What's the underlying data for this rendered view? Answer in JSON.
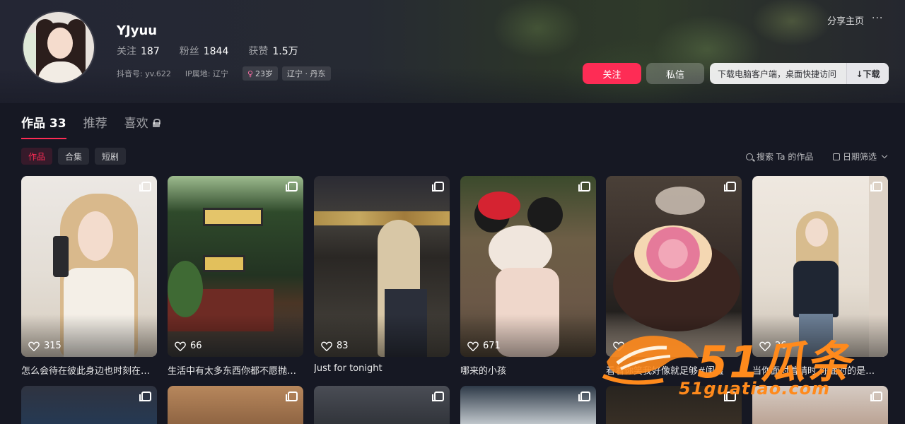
{
  "profile": {
    "username": "YJyuu",
    "stats": [
      {
        "label": "关注",
        "value": "187"
      },
      {
        "label": "粉丝",
        "value": "1844"
      },
      {
        "label": "获赞",
        "value": "1.5万"
      }
    ],
    "douyin_id": "抖音号: yv.622",
    "ip_location": "IP属地: 辽宁",
    "age_tag": "23岁",
    "region_tag": "辽宁 · 丹东"
  },
  "header_actions": {
    "share": "分享主页",
    "more": "···",
    "follow": "关注",
    "message": "私信",
    "download_text": "下载电脑客户端，桌面快捷访问",
    "download_button": "↓下载"
  },
  "tabs": [
    {
      "label": "作品 33",
      "active": true
    },
    {
      "label": "推荐",
      "active": false
    },
    {
      "label": "喜欢",
      "active": false,
      "locked": true
    }
  ],
  "subtabs": [
    {
      "label": "作品",
      "active": true
    },
    {
      "label": "合集",
      "active": false
    },
    {
      "label": "短剧",
      "active": false
    }
  ],
  "tools": {
    "search": "搜索 Ta 的作品",
    "date_filter": "日期筛选"
  },
  "videos": [
    {
      "likes": "315",
      "caption": "怎么会待在彼此身边也时刻在…"
    },
    {
      "likes": "66",
      "caption": "生活中有太多东西你都不愿抛…"
    },
    {
      "likes": "83",
      "caption": "Just for tonight"
    },
    {
      "likes": "671",
      "caption": "哪来的小孩"
    },
    {
      "likes": "",
      "caption": "看着你笑我好像就足够#闺蜜"
    },
    {
      "likes": "26",
      "caption": "当你面对着晴时 你面对的是在…"
    }
  ],
  "watermark": {
    "big": "51瓜条",
    "url": "51guatiao.com"
  },
  "colors": {
    "accent": "#fe2c55",
    "background": "#161823",
    "watermark": "#ff8a1c"
  }
}
